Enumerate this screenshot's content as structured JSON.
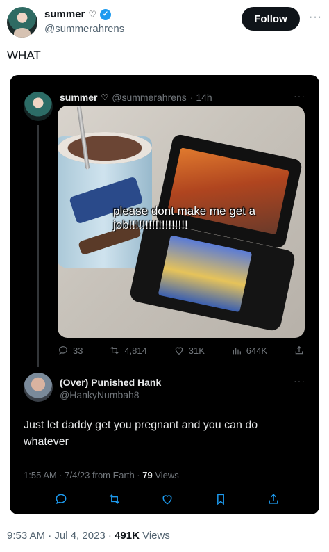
{
  "author": {
    "name": "summer",
    "heart": "♡",
    "handle": "@summerahrens",
    "follow_label": "Follow",
    "more": "···"
  },
  "tweet": {
    "text": "WHAT"
  },
  "quoted": {
    "name": "summer",
    "heart": "♡",
    "handle": "@summerahrens",
    "time": "· 14h",
    "more": "···",
    "caption": "please dont make me get a job!!!!!!!!!!!!!!!!!!",
    "stats": {
      "replies": "33",
      "retweets": "4,814",
      "likes": "31K",
      "views": "644K"
    }
  },
  "reply": {
    "name": "(Over) Punished Hank",
    "handle": "@HankyNumbah8",
    "more": "···",
    "text": "Just let daddy get you pregnant and you can do whatever",
    "time": "1:55 AM · 7/4/23 from Earth · ",
    "views_count": "79",
    "views_label": " Views"
  },
  "footer": {
    "time": "9:53 AM · Jul 4, 2023 · ",
    "views_count": "491K",
    "views_label": " Views"
  },
  "colors": {
    "accent": "#1d9bf0",
    "dark_bg": "#000000",
    "muted": "#71767b"
  }
}
